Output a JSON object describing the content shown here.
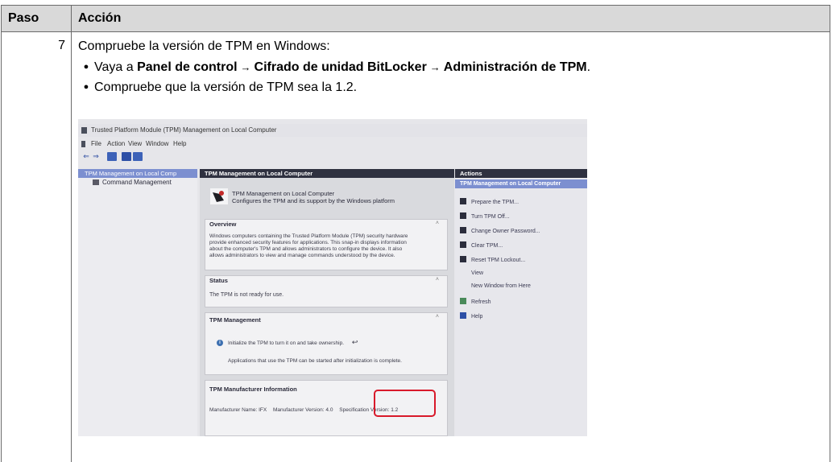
{
  "table": {
    "header_step": "Paso",
    "header_action": "Acción"
  },
  "step": {
    "number": "7",
    "intro": "Compruebe la versión de TPM en Windows:",
    "bullet1": {
      "prefix": "Vaya a ",
      "path1": "Panel de control",
      "arrow": "→",
      "path2": "Cifrado de unidad BitLocker",
      "path3": "Administración de TPM",
      "suffix": "."
    },
    "bullet2": "Compruebe que la versión de TPM sea la 1.2."
  },
  "screenshot": {
    "window_title": "Trusted Platform Module (TPM) Management on Local Computer",
    "menu": [
      "File",
      "Action",
      "View",
      "Window",
      "Help"
    ],
    "tree": {
      "root": "TPM Management on Local Comp",
      "child": "Command Management"
    },
    "center_header": "TPM Management on Local Computer",
    "intro_title": "TPM Management on Local Computer",
    "intro_subtitle": "Configures the TPM and its support by the Windows platform",
    "overview": {
      "title": "Overview",
      "lines": [
        "Windows computers containing the Trusted Platform Module (TPM) security hardware",
        "provide enhanced security features for applications. This snap-in displays information",
        "about the computer's TPM and allows administrators to configure the device. It also",
        "allows administrators to view and manage commands understood by the device."
      ]
    },
    "status": {
      "title": "Status",
      "text": "The TPM is not ready for use."
    },
    "tpm_management": {
      "title": "TPM Management",
      "line1": "Initialize the TPM to turn it on and take ownership.",
      "line2": "Applications that use the TPM can be started after initialization is complete."
    },
    "manufacturer": {
      "title": "TPM Manufacturer Information",
      "name_label": "Manufacturer Name:",
      "name_value": "IFX",
      "version_label": "Manufacturer Version:",
      "version_value": "4.0",
      "spec_label": "Specification Version:",
      "spec_value": "1.2"
    },
    "actions": {
      "header": "Actions",
      "subheader": "TPM Management on Local Computer",
      "items": [
        {
          "label": "Prepare the TPM...",
          "icon": "tpm-icon"
        },
        {
          "label": "Turn TPM Off...",
          "icon": "tpm-icon"
        },
        {
          "label": "Change Owner Password...",
          "icon": "tpm-icon"
        },
        {
          "label": "Clear TPM...",
          "icon": "tpm-icon"
        },
        {
          "label": "Reset TPM Lockout...",
          "icon": "tpm-icon"
        },
        {
          "label": "View",
          "icon": ""
        },
        {
          "label": "New Window from Here",
          "icon": ""
        },
        {
          "label": "Refresh",
          "icon": "refresh-icon"
        },
        {
          "label": "Help",
          "icon": "help-icon"
        }
      ]
    },
    "highlight_color": "#d8192a",
    "selection_color": "#7c8fd0"
  }
}
